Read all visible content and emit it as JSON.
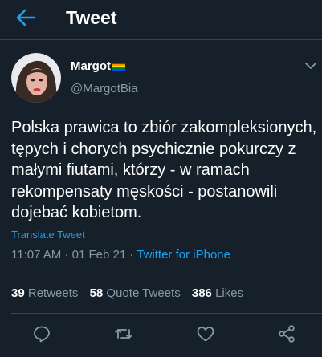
{
  "header": {
    "title": "Tweet"
  },
  "user": {
    "display_name": "Margot",
    "handle": "@MargotBia"
  },
  "tweet": {
    "text": "Polska prawica to zbiór zakompleksionych, tępych i chorych psychicznie pokurczy z małymi fiutami, którzy - w ramach rekompensaty męskości - postanowili dojebać kobietom.",
    "translate_label": "Translate Tweet",
    "time": "11:07 AM",
    "date": "01 Feb 21",
    "separator": "·",
    "source": "Twitter for iPhone"
  },
  "stats": {
    "retweets": {
      "count": "39",
      "label": "Retweets"
    },
    "quotes": {
      "count": "58",
      "label": "Quote Tweets"
    },
    "likes": {
      "count": "386",
      "label": "Likes"
    }
  },
  "icons": {
    "back": "arrow-left-icon",
    "flag": "rainbow-flag-icon",
    "more": "chevron-down-icon",
    "reply": "reply-icon",
    "retweet": "retweet-icon",
    "like": "heart-icon",
    "share": "share-icon"
  },
  "colors": {
    "background": "#15202b",
    "accent": "#1da1f2",
    "secondary_text": "#8899a6",
    "divider": "#38444d"
  }
}
